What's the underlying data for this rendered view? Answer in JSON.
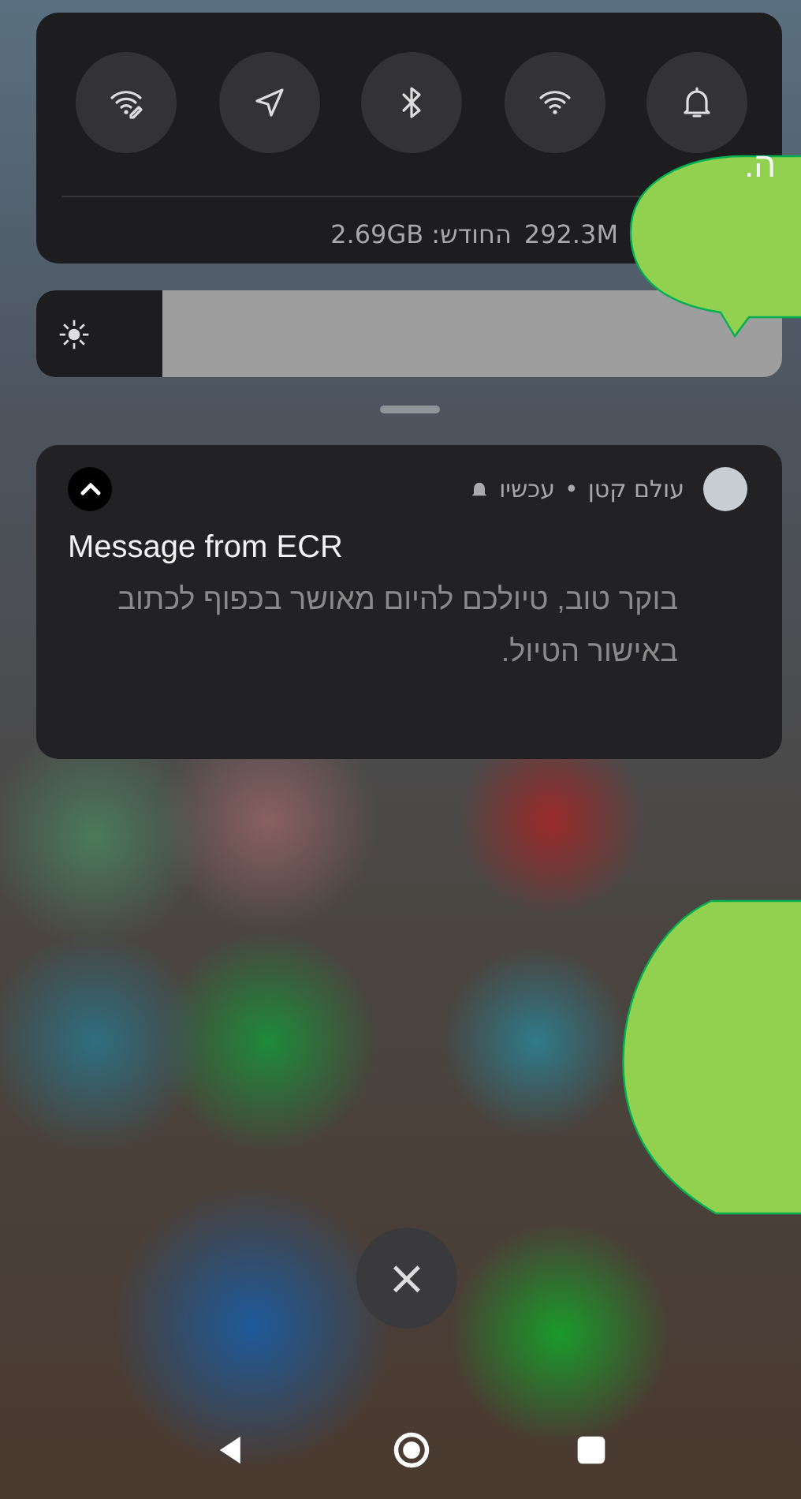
{
  "quick_settings": {
    "tiles": [
      {
        "kind": "wifi-edit"
      },
      {
        "kind": "location"
      },
      {
        "kind": "bluetooth"
      },
      {
        "kind": "wifi"
      },
      {
        "kind": "bell"
      }
    ],
    "data_usage": [
      {
        "text": "292.3M"
      },
      {
        "text": "החודש: 2.69GB"
      }
    ]
  },
  "brightness": {
    "level": 0.17
  },
  "notification": {
    "app": "עולם קטן",
    "time": "עכשיו",
    "separator": "•",
    "title": "Message from ECR",
    "body": "בוקר טוב, טיולכם להיום מאושר בכפוף לכתוב באישור הטיול.",
    "expanded": true
  },
  "callouts": [
    {
      "kind": "top",
      "text": "ה."
    },
    {
      "kind": "bottom"
    }
  ],
  "clear_button": {
    "label": "×"
  },
  "nav_bar": [
    {
      "kind": "back"
    },
    {
      "kind": "home"
    },
    {
      "kind": "recents"
    }
  ]
}
